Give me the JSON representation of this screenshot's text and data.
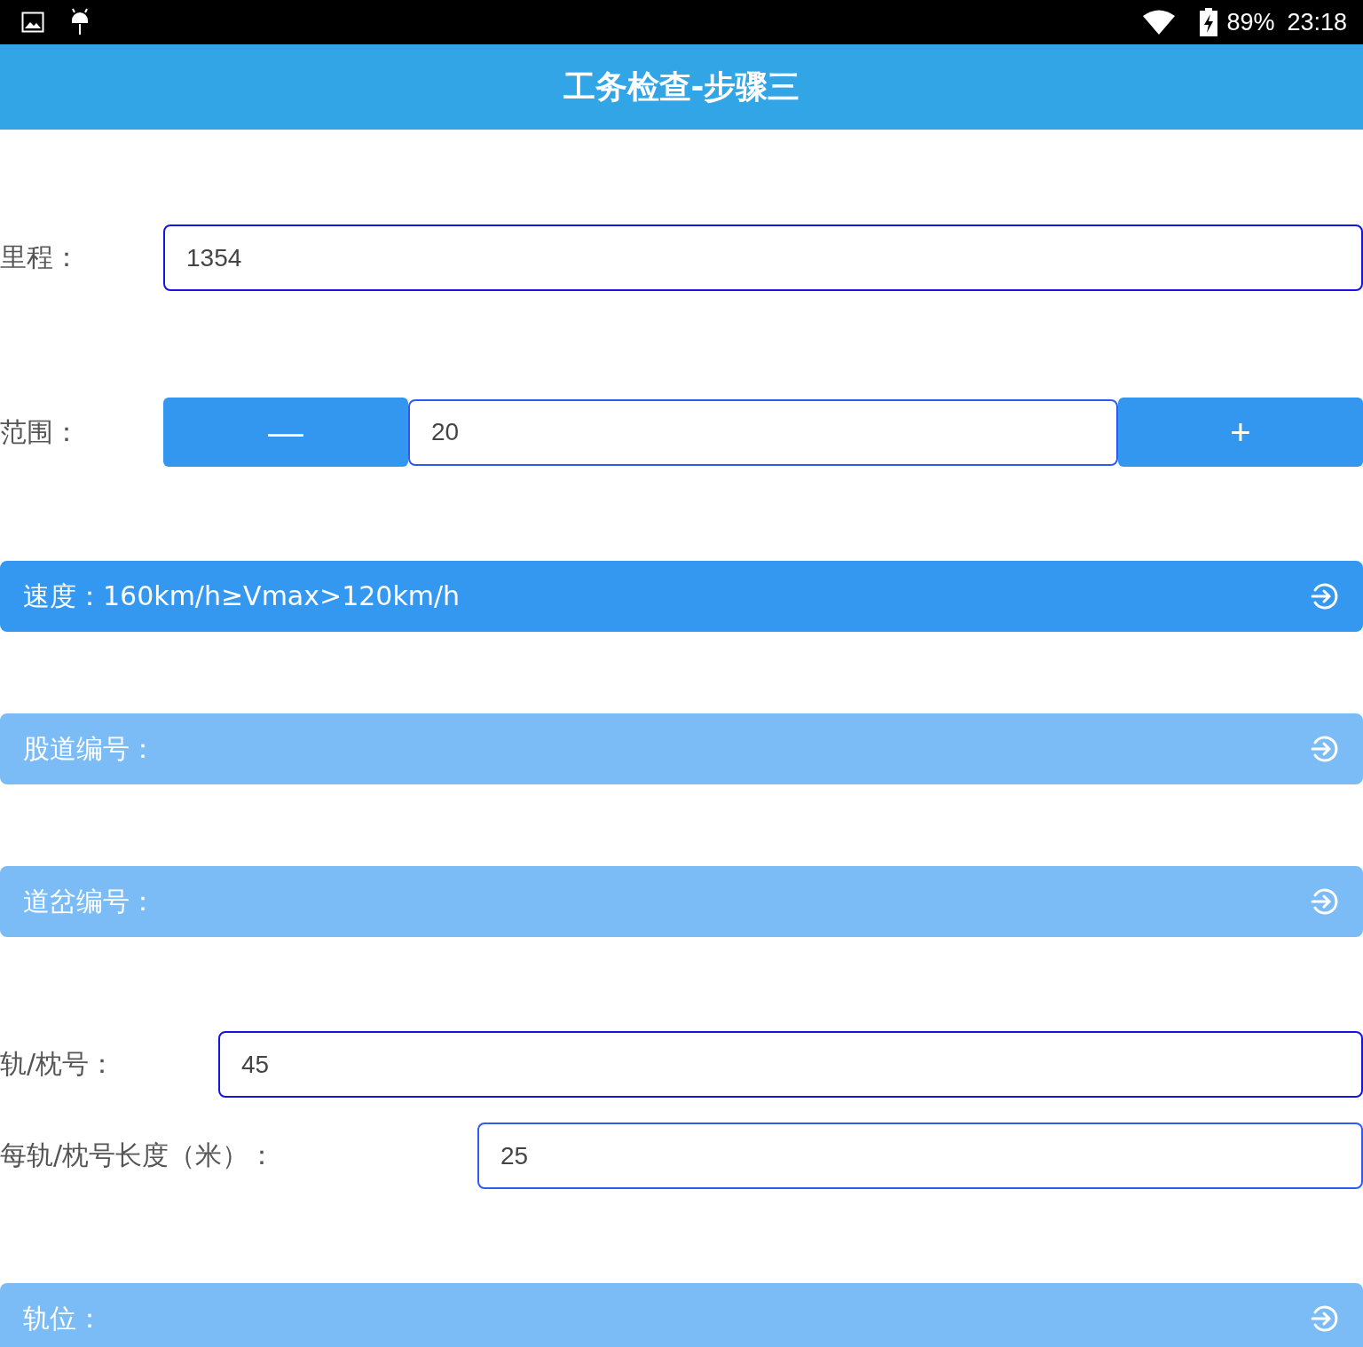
{
  "status_bar": {
    "battery": "89%",
    "time": "23:18"
  },
  "header": {
    "title": "工务检查-步骤三"
  },
  "mileage": {
    "label": "里程：",
    "value": "1354"
  },
  "range": {
    "label": "范围：",
    "minus": "—",
    "value": "20",
    "plus": "+"
  },
  "selectors_top": [
    {
      "label": "速度：",
      "value": "160km/h≥Vmax>120km/h",
      "active": true
    },
    {
      "label": "股道编号：",
      "active": false
    },
    {
      "label": "道岔编号：",
      "active": false
    }
  ],
  "rail_fields": [
    {
      "label": "轨/枕号：",
      "value": "45"
    },
    {
      "label": "每轨/枕号长度（米）：",
      "value": "25"
    }
  ],
  "selectors_bottom": [
    {
      "label": "轨位：",
      "active": false
    }
  ]
}
